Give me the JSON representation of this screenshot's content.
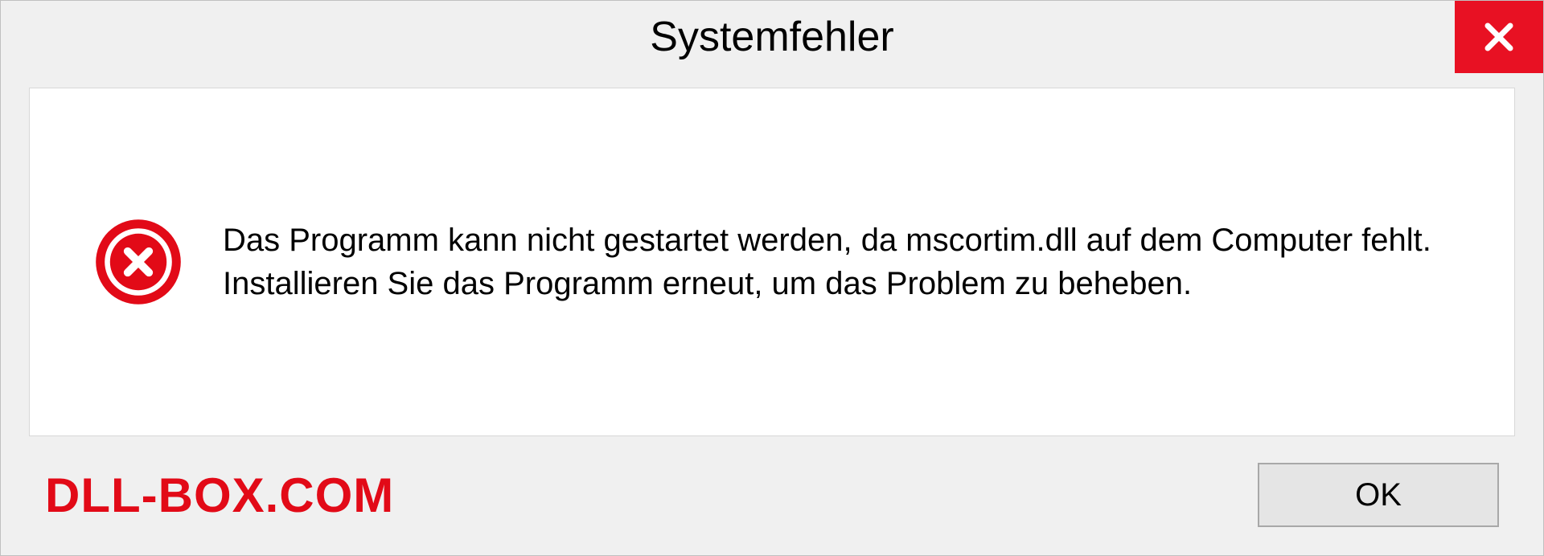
{
  "dialog": {
    "title": "Systemfehler",
    "message": "Das Programm kann nicht gestartet werden, da mscortim.dll auf dem Computer fehlt. Installieren Sie das Programm erneut, um das Problem zu beheben.",
    "ok_label": "OK"
  },
  "watermark": "DLL-BOX.COM"
}
